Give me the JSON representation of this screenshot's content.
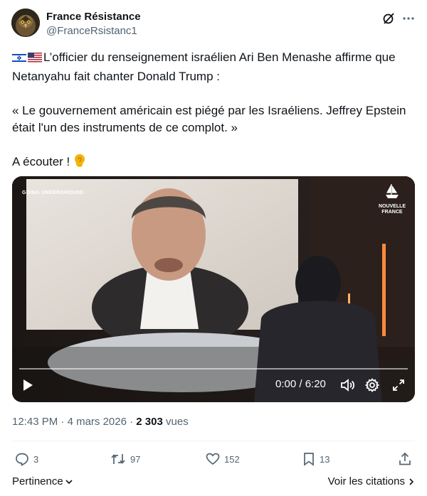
{
  "author": {
    "name": "France Résistance",
    "handle": "@FranceRsistanc1"
  },
  "tweet": {
    "line1": "L’officier du renseignement israélien Ari Ben Menashe affirme que Netanyahu fait chanter Donald Trump :",
    "line2": "« Le gouvernement américain est piégé par les Israéliens. Jeffrey Epstein était l'un des instruments de ce complot. »",
    "line3": "A écouter !",
    "flags": [
      "israel-flag",
      "usa-flag"
    ],
    "trailing_emoji": "ear-emoji"
  },
  "video": {
    "time_display": "0:00 / 6:20",
    "progress": 0,
    "overlay_left": "GOING UNDERGROUND",
    "overlay_right_line1": "NOUVELLE",
    "overlay_right_line2": "FRANCE"
  },
  "meta": {
    "time": "12:43 PM",
    "separator": "·",
    "date": "4 mars 2026",
    "views_count": "2 303",
    "views_label": "vues"
  },
  "actions": {
    "replies": "3",
    "reposts": "97",
    "likes": "152",
    "bookmarks": "13"
  },
  "footer": {
    "sort_label": "Pertinence",
    "quotes_label": "Voir les citations"
  },
  "colors": {
    "text_primary": "#0f1419",
    "text_secondary": "#536471",
    "divider": "#eff3f4"
  }
}
